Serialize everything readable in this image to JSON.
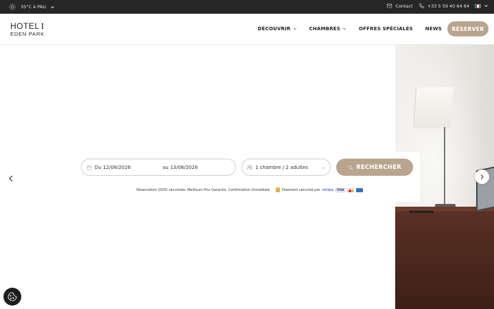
{
  "topbar": {
    "weather": "35°C à PAU",
    "contact_label": "Contact",
    "phone": "+33 5 59 40 64 64",
    "flag_colors": [
      "#0055a4",
      "#ffffff",
      "#ef4135"
    ]
  },
  "header": {
    "logo_line1": "HOTEL",
    "logo_line2": "EDEN PARK",
    "nav": [
      {
        "label": "DÉCOUVRIR"
      },
      {
        "label": "CHAMBRES"
      },
      {
        "label": "OFFRES SPÉCIALES"
      },
      {
        "label": "NEWS"
      }
    ],
    "reserve_label": "RÉSERVER"
  },
  "booking": {
    "date_from": "Du 12/08/2026",
    "date_to": "au 13/08/2026",
    "guests": "1 chambre / 2 adultes",
    "search_label": "RECHERCHER",
    "assurance": "Réservation 100% sécurisée, Meilleurs Prix Garantis, Confirmation Immédiate",
    "secure_label": "Paiement sécurisé par",
    "stripe_label": "stripe",
    "visa_label": "VISA"
  },
  "colors": {
    "accent": "#b9a48e",
    "topbar": "#262626"
  }
}
